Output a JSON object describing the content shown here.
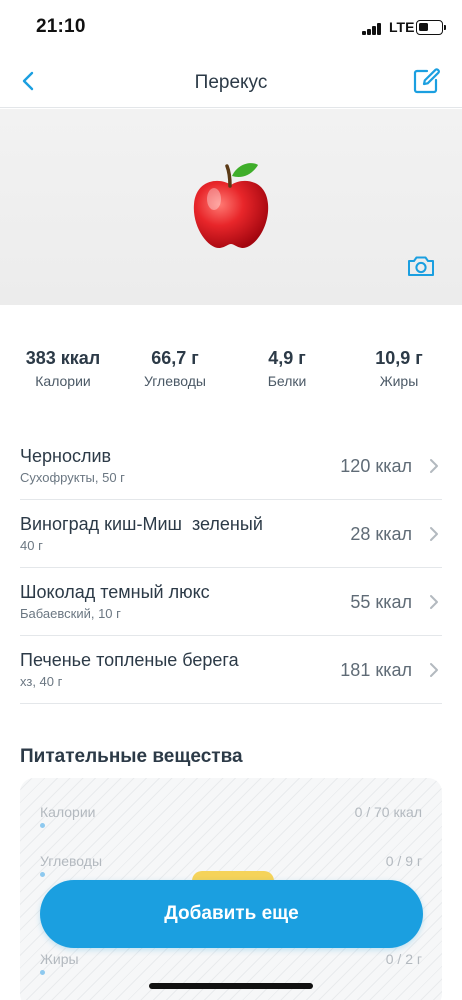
{
  "status_bar": {
    "time": "21:10",
    "network": "LTE"
  },
  "nav": {
    "title": "Перекус"
  },
  "summary": [
    {
      "value": "383 ккал",
      "label": "Калории"
    },
    {
      "value": "66,7 г",
      "label": "Углеводы"
    },
    {
      "value": "4,9 г",
      "label": "Белки"
    },
    {
      "value": "10,9 г",
      "label": "Жиры"
    }
  ],
  "foods": [
    {
      "name": "Чернослив",
      "detail": "Сухофрукты, 50 г",
      "kcal": "120 ккал"
    },
    {
      "name": "Виноград киш-Миш  зеленый",
      "detail": "40 г",
      "kcal": "28 ккал"
    },
    {
      "name": "Шоколад темный люкс",
      "detail": "Бабаевский, 10 г",
      "kcal": "55 ккал"
    },
    {
      "name": "Печенье топленые берега",
      "detail": "хз, 40 г",
      "kcal": "181 ккал"
    }
  ],
  "nutrients": {
    "title": "Питательные вещества",
    "items": [
      {
        "name": "Калории",
        "value": "0 / 70 ккал"
      },
      {
        "name": "Углеводы",
        "value": "0 / 9 г"
      },
      {
        "name": "Жиры",
        "value": "0 / 2 г"
      }
    ]
  },
  "add_button": {
    "label": "Добавить еще"
  },
  "icons": {
    "back": "chevron-left-icon",
    "edit": "edit-icon",
    "camera": "camera-icon",
    "hero": "apple-icon",
    "row_chevron": "chevron-right-icon"
  },
  "colors": {
    "accent": "#1b9fe0",
    "text": "#2c3a47"
  }
}
